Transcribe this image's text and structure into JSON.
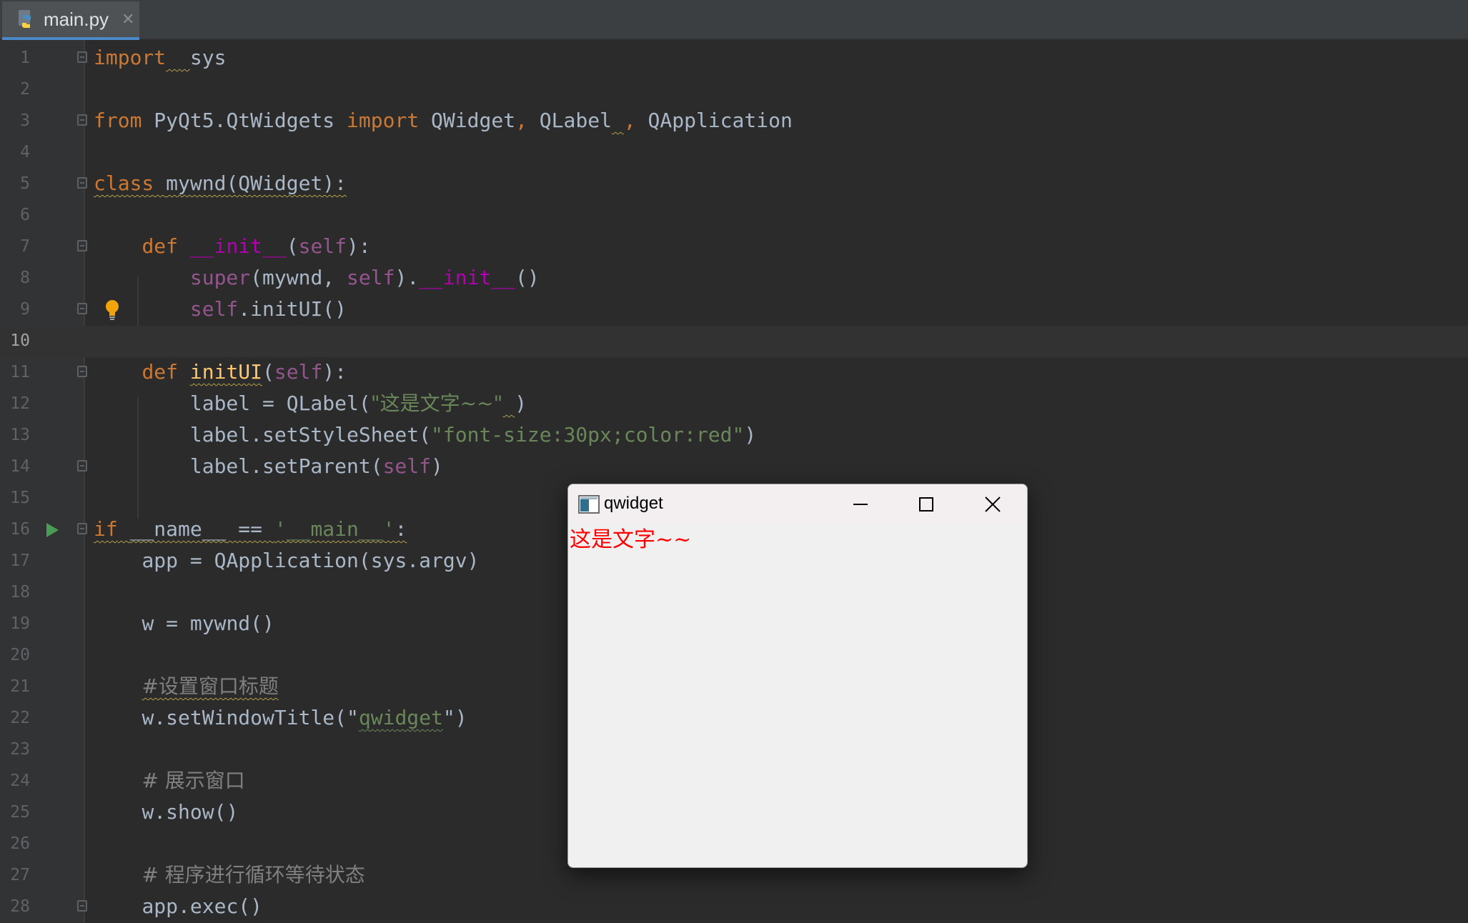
{
  "editor": {
    "tab": {
      "filename": "main.py",
      "icon": "python-file-icon",
      "close_glyph": "✕"
    },
    "current_line": 10,
    "lines": [
      {
        "n": "1"
      },
      {
        "n": "2"
      },
      {
        "n": "3"
      },
      {
        "n": "4"
      },
      {
        "n": "5"
      },
      {
        "n": "6"
      },
      {
        "n": "7"
      },
      {
        "n": "8"
      },
      {
        "n": "9"
      },
      {
        "n": "10"
      },
      {
        "n": "11"
      },
      {
        "n": "12"
      },
      {
        "n": "13"
      },
      {
        "n": "14"
      },
      {
        "n": "15"
      },
      {
        "n": "16"
      },
      {
        "n": "17"
      },
      {
        "n": "18"
      },
      {
        "n": "19"
      },
      {
        "n": "20"
      },
      {
        "n": "21"
      },
      {
        "n": "22"
      },
      {
        "n": "23"
      },
      {
        "n": "24"
      },
      {
        "n": "25"
      },
      {
        "n": "26"
      },
      {
        "n": "27"
      },
      {
        "n": "28"
      }
    ],
    "tokens": {
      "l1_kw": "import",
      "l1_mod": "sys",
      "l3_from": "from",
      "l3_pkg": "PyQt5.QtWidgets",
      "l3_import": "import",
      "l3_a": "QWidget",
      "l3_b": "QLabel",
      "l3_c": "QApplication",
      "l5_kw": "class",
      "l5_rest": "mywnd(QWidget):",
      "l7_def": "def",
      "l7_init": "__init__",
      "l7_self": "self",
      "l8_super": "super",
      "l8_mid": "mywnd, ",
      "l8_self": "self",
      "l8_init": "__init__",
      "l9_self": "self",
      "l9_rest": ".initUI()",
      "l11_def": "def",
      "l11_fn": "initUI",
      "l11_self": "self",
      "l12_pre": "label = QLabel(",
      "l12_str": "\"这是文字~~\"",
      "l12_post": ")",
      "l13_pre": "label.setStyleSheet(",
      "l13_str": "\"font-size:30px;color:red\"",
      "l13_post": ")",
      "l14_pre": "label.setParent(",
      "l14_self": "self",
      "l14_post": ")",
      "l16_if": "if",
      "l16_name": "__name__",
      "l16_eq": " == ",
      "l16_str": "'__main__'",
      "l16_colon": ":",
      "l17": "app = QApplication(sys.argv)",
      "l19": "w = mywnd()",
      "l21_cmt": "#设置窗口标题",
      "l22_pre": "w.setWindowTitle(\"",
      "l22_str": "qwidget",
      "l22_post": "\")",
      "l24_cmt": "# 展示窗口",
      "l25": "w.show()",
      "l27_cmt": "# 程序进行循环等待状态",
      "l28": "app.exec()"
    }
  },
  "qt_window": {
    "title": "qwidget",
    "label_text": "这是文字~~",
    "label_color": "#ff0000",
    "buttons": [
      "minimize-icon",
      "maximize-icon",
      "close-icon"
    ]
  },
  "colors": {
    "keyword": "#cc7832",
    "string": "#6a8759",
    "self": "#94558d",
    "magic": "#b200b2",
    "function": "#ffc66d",
    "comment": "#808080",
    "background": "#2b2b2b"
  }
}
